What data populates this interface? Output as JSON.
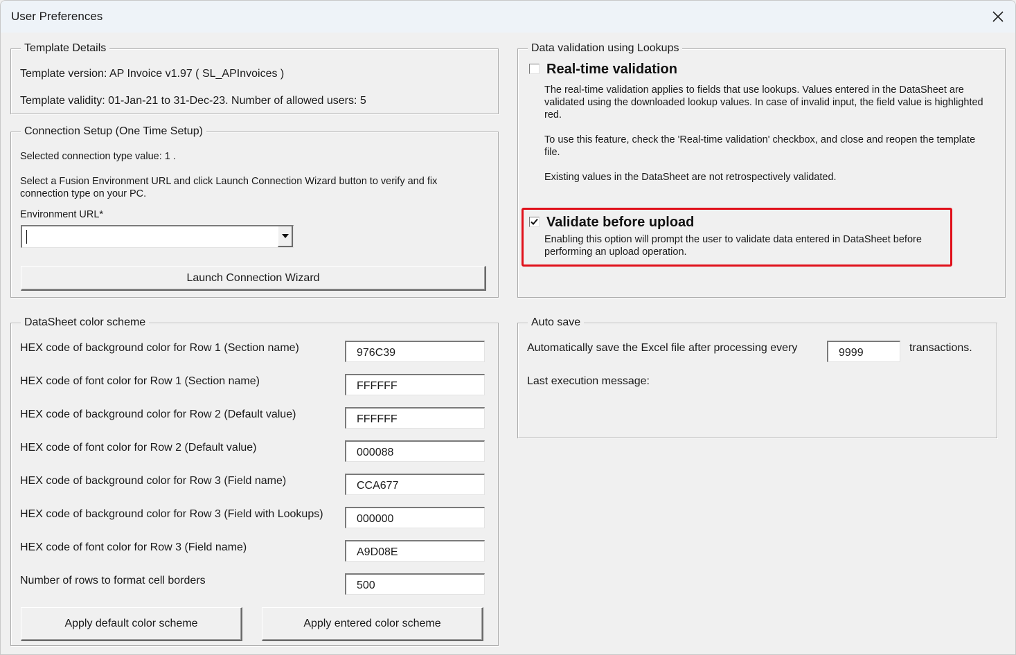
{
  "window": {
    "title": "User Preferences",
    "close_icon": "close-icon"
  },
  "template_details": {
    "legend": "Template Details",
    "version_text": "Template version: AP Invoice v1.97 ( SL_APInvoices )",
    "validity_text": "Template validity: 01-Jan-21 to 31-Dec-23. Number of allowed users: 5"
  },
  "connection_setup": {
    "legend": "Connection Setup (One Time Setup)",
    "selected_type_text": "Selected connection type value: 1 .",
    "instructions": "Select a Fusion Environment URL and click Launch Connection Wizard button to verify and fix connection type on your PC.",
    "env_url_label": "Environment URL*",
    "env_url_value": "",
    "dropdown_icon": "chevron-down-icon",
    "launch_button": "Launch Connection Wizard"
  },
  "color_scheme": {
    "legend": "DataSheet color scheme",
    "rows": [
      {
        "label": "HEX code of background color for Row 1 (Section name)",
        "value": "976C39"
      },
      {
        "label": "HEX code of font color for Row 1 (Section name)",
        "value": "FFFFFF"
      },
      {
        "label": "HEX code of background color for Row 2 (Default value)",
        "value": "FFFFFF"
      },
      {
        "label": "HEX code of font color for Row 2 (Default value)",
        "value": "000088"
      },
      {
        "label": "HEX code of background color for Row 3 (Field name)",
        "value": "CCA677"
      },
      {
        "label": "HEX code of background color for Row 3 (Field with Lookups)",
        "value": "000000"
      },
      {
        "label": "HEX code of font color for Row 3 (Field name)",
        "value": "A9D08E"
      },
      {
        "label": "Number of rows to format cell borders",
        "value": "500"
      }
    ],
    "apply_default_button": "Apply default color scheme",
    "apply_entered_button": "Apply entered color scheme"
  },
  "data_validation": {
    "legend": "Data validation using Lookups",
    "realtime": {
      "label": "Real-time validation",
      "checked": false,
      "desc1": "The real-time validation applies to fields that use lookups. Values entered in the DataSheet are validated using the downloaded lookup values. In case of invalid input, the field value is highlighted red.",
      "desc2": "To use this feature, check the 'Real-time validation' checkbox, and close and reopen the template file.",
      "desc3": "Existing values in the DataSheet are not retrospectively validated."
    },
    "validate_before_upload": {
      "label": "Validate before upload",
      "checked": true,
      "desc": "Enabling this option will prompt the user to validate data entered in DataSheet before performing an upload operation."
    },
    "highlight_color": "#e0101a"
  },
  "auto_save": {
    "legend": "Auto save",
    "prefix": "Automatically save the Excel file after processing every",
    "value": "9999",
    "suffix": "transactions.",
    "last_message_label": "Last execution message:",
    "last_message": ""
  }
}
